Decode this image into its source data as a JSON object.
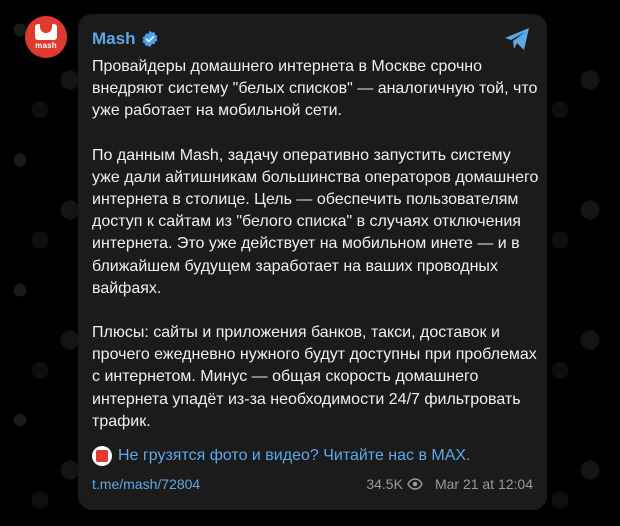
{
  "avatar": {
    "logo_text": "mash"
  },
  "channel": {
    "name": "Mash"
  },
  "post": {
    "paragraphs": [
      "Провайдеры домашнего интернета в Москве срочно внедряют систему \"белых списков\" — аналогичную той, что уже работает на мобильной сети.",
      "По данным Mash, задачу оперативно запустить систему уже дали айтишникам большинства операторов домашнего интернета в столице. Цель — обеспечить пользователям доступ к сайтам из \"белого списка\" в случаях отключения интернета. Это уже действует на мобильном инете — и в ближайшем будущем заработает на ваших проводных вайфаях.",
      "Плюсы: сайты и приложения банков, такси, доставок и прочего ежедневно нужного будут доступны при проблемах с интернетом. Минус — общая скорость домашнего интернета упадёт из-за необходимости 24/7 фильтровать трафик."
    ],
    "promo_link": "Не грузятся фото и видео? Читайте нас в MAX.",
    "post_link": "t.me/mash/72804",
    "views": "34.5K",
    "date": "Mar 21 at 12:04"
  },
  "colors": {
    "background": "#000000",
    "card": "#1b1b1b",
    "accent": "#5fa8e8",
    "brand_red": "#e03a2f",
    "meta_text": "#9a9a9a"
  },
  "icons": [
    "verified-icon",
    "telegram-share-icon",
    "eye-icon",
    "mash-logo-icon"
  ]
}
